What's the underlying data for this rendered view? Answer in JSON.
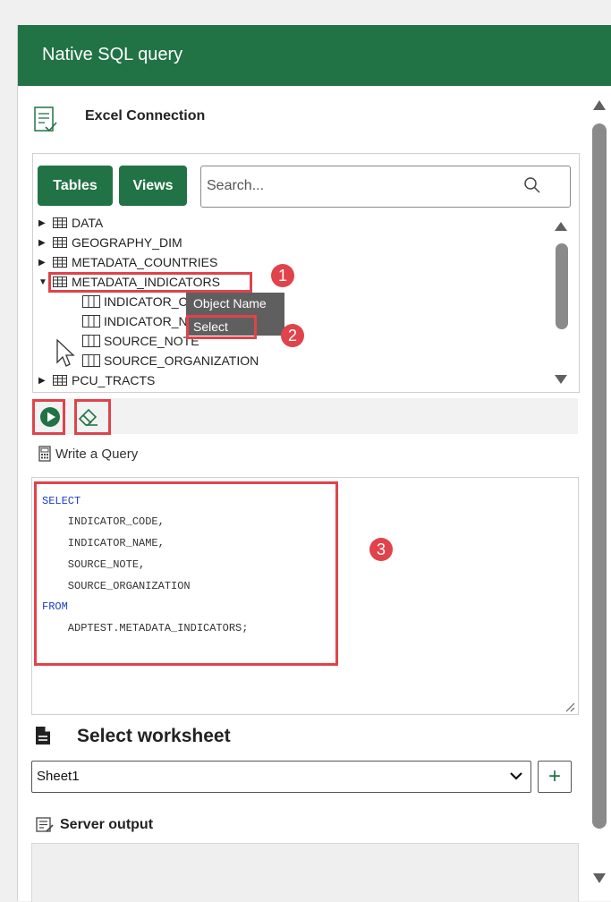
{
  "header": {
    "title": "Native SQL query"
  },
  "connection": {
    "label": "Excel Connection"
  },
  "browser": {
    "tables_button": "Tables",
    "views_button": "Views",
    "search_placeholder": "Search...",
    "tables": [
      {
        "name": "DATA",
        "expanded": false
      },
      {
        "name": "GEOGRAPHY_DIM",
        "expanded": false
      },
      {
        "name": "METADATA_COUNTRIES",
        "expanded": false
      },
      {
        "name": "METADATA_INDICATORS",
        "expanded": true
      },
      {
        "name": "PCU_TRACTS",
        "expanded": false
      }
    ],
    "columns": [
      "INDICATOR_CODE",
      "INDICATOR_NAME",
      "SOURCE_NOTE",
      "SOURCE_ORGANIZATION"
    ],
    "context_menu": [
      "Object Name",
      "Select"
    ]
  },
  "annotations": [
    "1",
    "2",
    "3"
  ],
  "query": {
    "label": "Write a Query",
    "lines": [
      "SELECT",
      "    INDICATOR_CODE,",
      "    INDICATOR_NAME,",
      "    SOURCE_NOTE,",
      "    SOURCE_ORGANIZATION",
      "FROM",
      "    ADPTEST.METADATA_INDICATORS;"
    ]
  },
  "worksheet": {
    "label": "Select worksheet",
    "selected": "Sheet1",
    "add_label": "+"
  },
  "output": {
    "label": "Server output"
  },
  "colors": {
    "brand": "#217346",
    "annotation": "#e0434b",
    "keyword": "#1a3cc8"
  }
}
